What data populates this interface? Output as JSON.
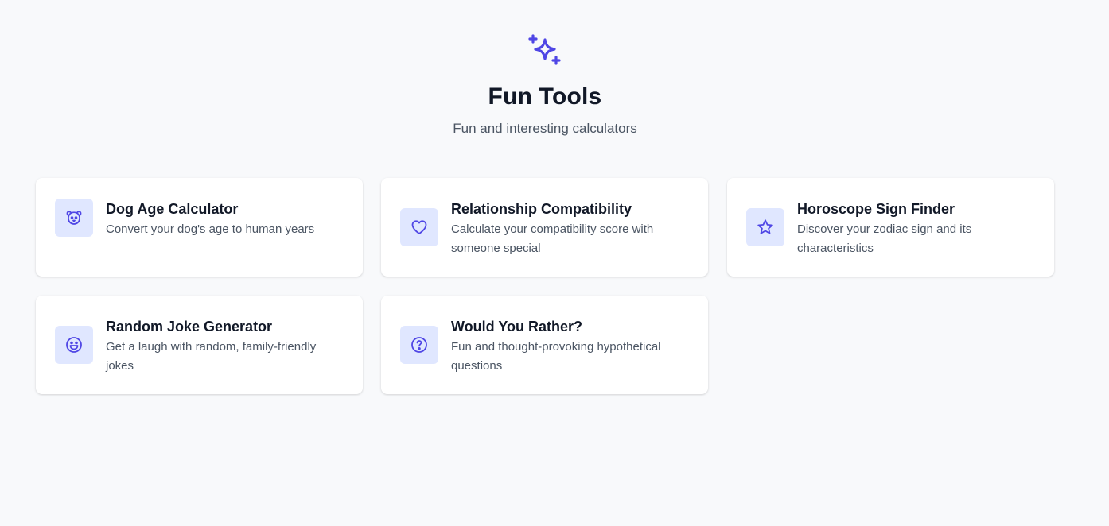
{
  "header": {
    "icon": "sparkles-icon",
    "title": "Fun Tools",
    "subtitle": "Fun and interesting calculators"
  },
  "colors": {
    "accent": "#4f46e5",
    "icon_bg": "#e0e7ff",
    "background": "#f8f9fb",
    "card_bg": "#ffffff"
  },
  "tools": [
    {
      "icon": "dog-icon",
      "title": "Dog Age Calculator",
      "description": "Convert your dog's age to human years"
    },
    {
      "icon": "heart-icon",
      "title": "Relationship Compatibility",
      "description": "Calculate your compatibility score with someone special"
    },
    {
      "icon": "star-icon",
      "title": "Horoscope Sign Finder",
      "description": "Discover your zodiac sign and its characteristics"
    },
    {
      "icon": "smile-icon",
      "title": "Random Joke Generator",
      "description": "Get a laugh with random, family-friendly jokes"
    },
    {
      "icon": "question-circle-icon",
      "title": "Would You Rather?",
      "description": "Fun and thought-provoking hypothetical questions"
    }
  ]
}
